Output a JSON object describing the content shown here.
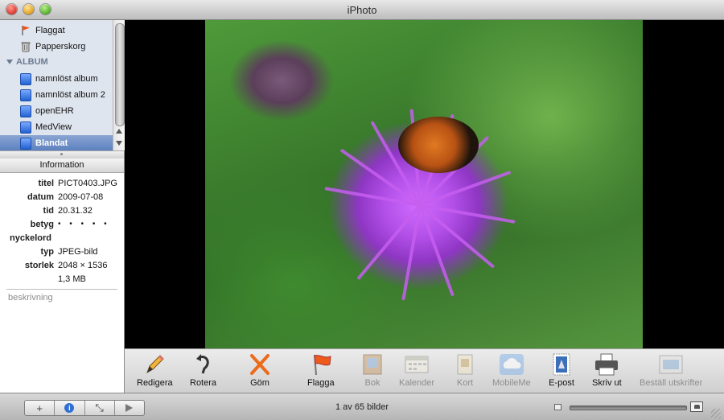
{
  "window": {
    "title": "iPhoto"
  },
  "sidebar": {
    "top_items": [
      {
        "label": "Flaggat",
        "icon": "flag-icon"
      },
      {
        "label": "Papperskorg",
        "icon": "trash-icon"
      }
    ],
    "album_section": "ALBUM",
    "albums": [
      {
        "label": "namnlöst album",
        "selected": false
      },
      {
        "label": "namnlöst album 2",
        "selected": false
      },
      {
        "label": "openEHR",
        "selected": false
      },
      {
        "label": "MedView",
        "selected": false
      },
      {
        "label": "Blandat",
        "selected": true
      }
    ],
    "accent": "#5a7fbf"
  },
  "info": {
    "header": "Information",
    "rows": [
      {
        "key": "titel",
        "value": "PICT0403.JPG"
      },
      {
        "key": "datum",
        "value": "2009-07-08"
      },
      {
        "key": "tid",
        "value": "20.31.32"
      },
      {
        "key": "betyg",
        "value": "• • • • •"
      },
      {
        "key": "nyckelord",
        "value": ""
      },
      {
        "key": "typ",
        "value": "JPEG-bild"
      },
      {
        "key": "storlek",
        "value": "2048 × 1536"
      },
      {
        "key": "",
        "value": "1,3 MB"
      }
    ],
    "description_placeholder": "beskrivning"
  },
  "toolbar": {
    "tools": [
      {
        "label": "Redigera",
        "icon": "pencil-icon",
        "enabled": true
      },
      {
        "label": "Rotera",
        "icon": "rotate-icon",
        "enabled": true
      },
      {
        "label": "Göm",
        "icon": "hide-x-icon",
        "enabled": true
      },
      {
        "label": "Flagga",
        "icon": "flag-icon",
        "enabled": true
      },
      {
        "label": "Bok",
        "icon": "book-icon",
        "enabled": false
      },
      {
        "label": "Kalender",
        "icon": "calendar-icon",
        "enabled": false
      },
      {
        "label": "Kort",
        "icon": "card-icon",
        "enabled": false
      },
      {
        "label": "MobileMe",
        "icon": "cloud-icon",
        "enabled": false
      },
      {
        "label": "E-post",
        "icon": "stamp-icon",
        "enabled": true
      },
      {
        "label": "Skriv ut",
        "icon": "printer-icon",
        "enabled": true
      },
      {
        "label": "Beställ utskrifter",
        "icon": "order-prints-icon",
        "enabled": false
      }
    ]
  },
  "bottombar": {
    "buttons": [
      {
        "icon": "add-icon",
        "glyph": "+"
      },
      {
        "icon": "info-icon",
        "glyph": "i"
      },
      {
        "icon": "fullscreen-icon",
        "glyph": "⤡"
      },
      {
        "icon": "play-icon",
        "glyph": ""
      }
    ],
    "count": "1 av 65 bilder"
  }
}
